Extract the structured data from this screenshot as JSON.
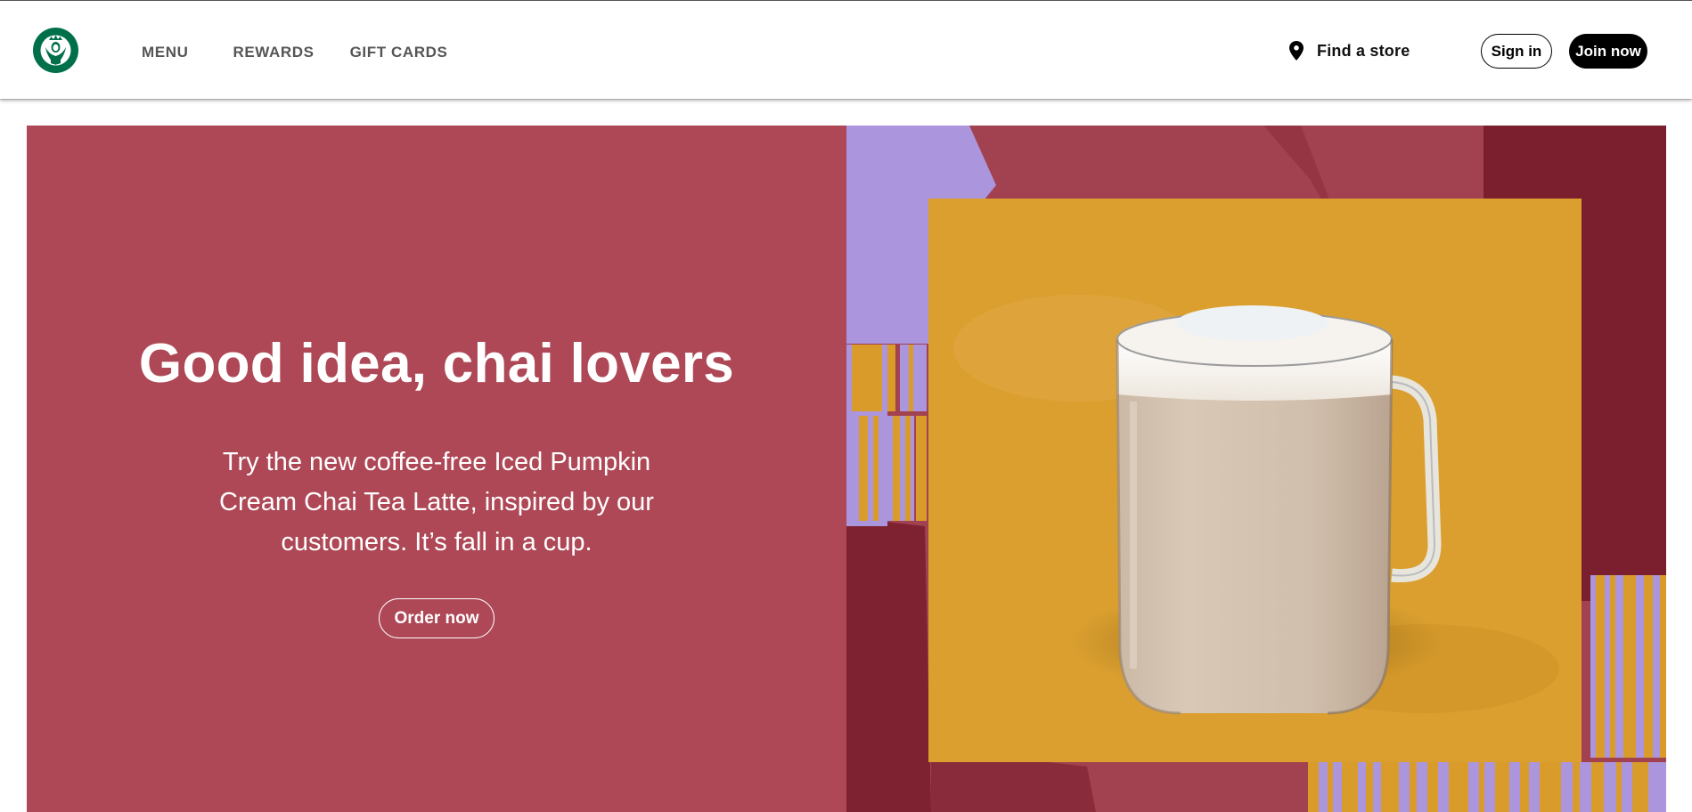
{
  "header": {
    "logo_icon": "starbucks-siren-logo-icon",
    "nav": [
      {
        "label": "MENU"
      },
      {
        "label": "REWARDS"
      },
      {
        "label": "GIFT CARDS"
      }
    ],
    "find_store": {
      "icon": "location-pin-icon",
      "label": "Find a store"
    },
    "sign_in_label": "Sign in",
    "join_label": "Join now"
  },
  "hero": {
    "title": "Good idea, chai lovers",
    "body": "Try the new coffee-free Iced Pumpkin Cream Chai Tea Latte, inspired by our customers. It’s fall in a cup.",
    "cta_label": "Order now",
    "image": "chai-tea-latte-glass-mug",
    "colors": {
      "panel": "#ae4856",
      "lavender": "#aa96de",
      "mustard": "#d99c2b",
      "maroon": "#7a1f2e",
      "brand_green": "#00704a"
    }
  }
}
